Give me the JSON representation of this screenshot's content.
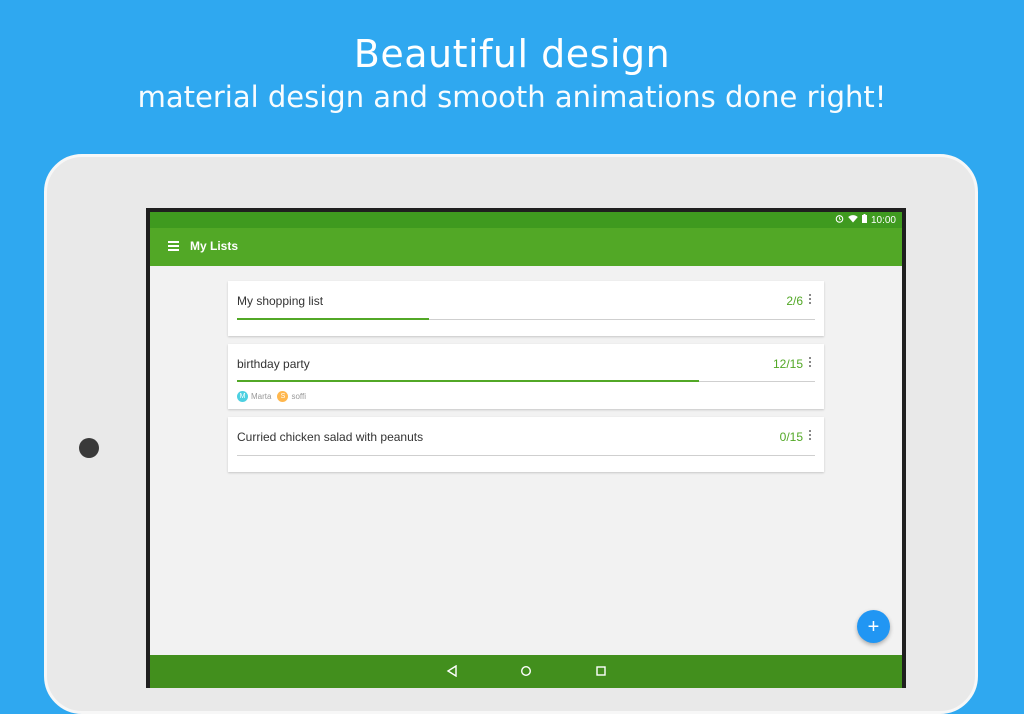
{
  "promo": {
    "headline": "Beautiful design",
    "subline": "material design and smooth animations done right!"
  },
  "colors": {
    "background": "#2fa8f0",
    "appbar": "#52a826",
    "statusbar": "#3f9a1f",
    "navbar": "#428f1d",
    "accent": "#52a826",
    "fab": "#2196f3"
  },
  "statusbar": {
    "time": "10:00",
    "icons": [
      "alarm-icon",
      "wifi-icon",
      "battery-icon"
    ]
  },
  "appbar": {
    "title": "My Lists",
    "menu_icon": "hamburger-menu-icon"
  },
  "lists": [
    {
      "title": "My shopping list",
      "count": "2/6",
      "progress": 0.333,
      "members": []
    },
    {
      "title": "birthday party",
      "count": "12/15",
      "progress": 0.8,
      "members": [
        {
          "initial": "M",
          "name": "Marta",
          "color": "#4dd0e1"
        },
        {
          "initial": "S",
          "name": "soffi",
          "color": "#ffb74d"
        }
      ]
    },
    {
      "title": "Curried chicken salad with peanuts",
      "count": "0/15",
      "progress": 0.0,
      "members": []
    }
  ],
  "fab": {
    "icon": "plus-icon",
    "symbol": "+"
  },
  "navbar": {
    "icons": [
      "back-icon",
      "home-icon",
      "recents-icon"
    ]
  }
}
